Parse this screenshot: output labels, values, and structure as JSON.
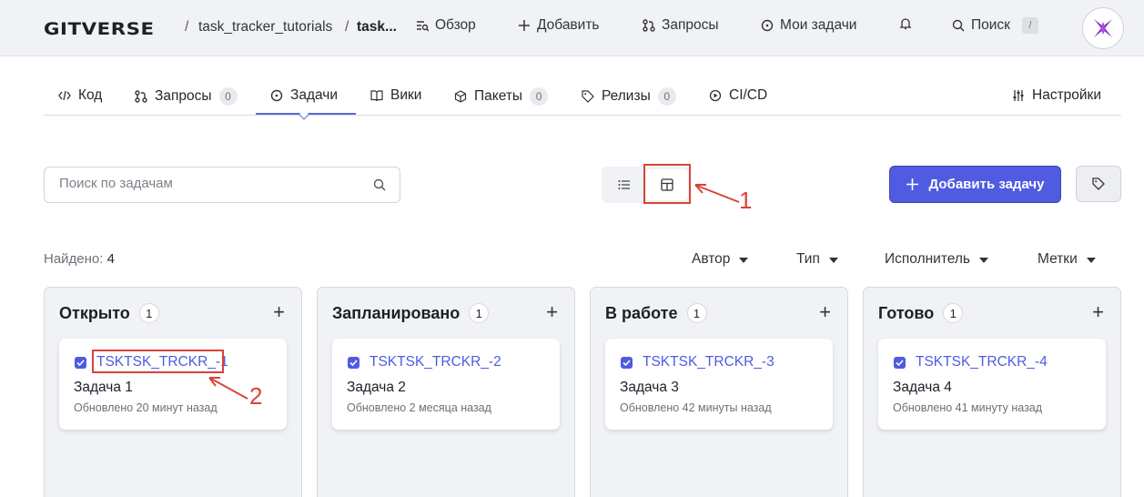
{
  "header": {
    "logo": "GITVERSE",
    "sep1": "/",
    "repo_owner": "task_tracker_tutorials",
    "sep2": "/",
    "repo_name": "task...",
    "nav": [
      {
        "label": "Обзор",
        "icon": "overview-icon"
      },
      {
        "label": "Добавить",
        "icon": "plus-icon"
      },
      {
        "label": "Запросы",
        "icon": "pull-request-icon"
      },
      {
        "label": "Мои задачи",
        "icon": "issue-icon"
      }
    ],
    "bell_icon": "bell-icon",
    "search_label": "Поиск",
    "search_shortcut": "/"
  },
  "tabs": [
    {
      "label": "Код",
      "icon": "code-icon"
    },
    {
      "label": "Запросы",
      "icon": "pull-request-icon",
      "count": "0"
    },
    {
      "label": "Задачи",
      "icon": "issue-icon",
      "active": true
    },
    {
      "label": "Вики",
      "icon": "book-icon"
    },
    {
      "label": "Пакеты",
      "icon": "package-icon",
      "count": "0"
    },
    {
      "label": "Релизы",
      "icon": "tag-icon",
      "count": "0"
    },
    {
      "label": "CI/CD",
      "icon": "play-icon"
    }
  ],
  "settings_label": "Настройки",
  "toolbar": {
    "search_placeholder": "Поиск по задачам",
    "add_task_label": "Добавить задачу"
  },
  "found": {
    "label": "Найдено:",
    "count": "4"
  },
  "filters": [
    "Автор",
    "Тип",
    "Исполнитель",
    "Метки"
  ],
  "columns": [
    {
      "title": "Открыто",
      "count": "1",
      "cards": [
        {
          "id": "TSKTSK_TRCKR_-1",
          "name": "Задача 1",
          "updated": "Обновлено 20 минут назад"
        }
      ]
    },
    {
      "title": "Запланировано",
      "count": "1",
      "cards": [
        {
          "id": "TSKTSK_TRCKR_-2",
          "name": "Задача 2",
          "updated": "Обновлено 2 месяца назад"
        }
      ]
    },
    {
      "title": "В работе",
      "count": "1",
      "cards": [
        {
          "id": "TSKTSK_TRCKR_-3",
          "name": "Задача 3",
          "updated": "Обновлено 42 минуты назад"
        }
      ]
    },
    {
      "title": "Готово",
      "count": "1",
      "cards": [
        {
          "id": "TSKTSK_TRCKR_-4",
          "name": "Задача 4",
          "updated": "Обновлено 41 минуту назад"
        }
      ]
    }
  ],
  "annotations": {
    "one": "1",
    "two": "2"
  },
  "colors": {
    "accent": "#4f5be0",
    "annotation": "#d9433a",
    "header_bg": "#f0f2f5"
  }
}
